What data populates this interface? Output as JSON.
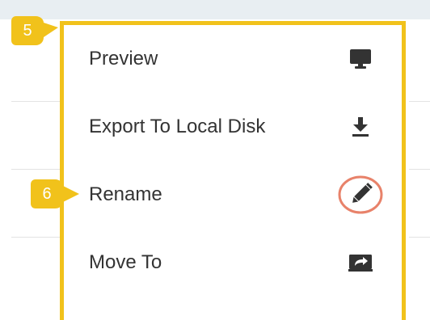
{
  "badges": {
    "step_5": "5",
    "step_6": "6"
  },
  "menu": {
    "items": [
      {
        "label": "Preview",
        "icon": "monitor-icon"
      },
      {
        "label": "Export To Local Disk",
        "icon": "download-icon"
      },
      {
        "label": "Rename",
        "icon": "pencil-icon"
      },
      {
        "label": "Move To",
        "icon": "move-folder-icon"
      }
    ]
  },
  "colors": {
    "highlight_border": "#f1c21b",
    "badge": "#f1c21b",
    "icon": "#333333",
    "rename_circle": "#e8826a"
  }
}
